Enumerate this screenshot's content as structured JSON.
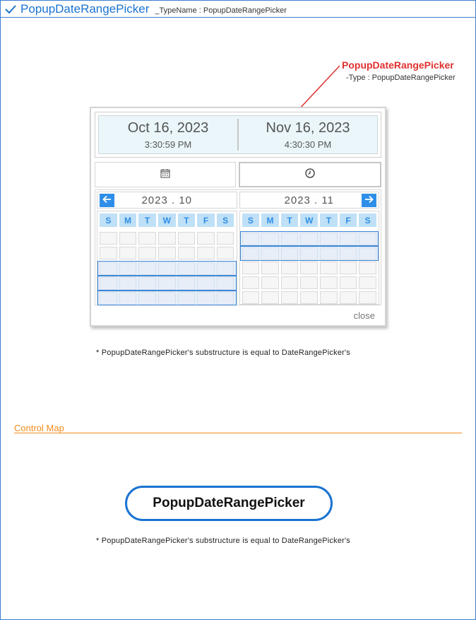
{
  "header": {
    "title": "PopupDateRangePicker",
    "typename": "_TypeName : PopupDateRangePicker"
  },
  "callout": {
    "title": "PopupDateRangePicker",
    "type": "-Type : PopupDateRangePicker"
  },
  "picker": {
    "start": {
      "date": "Oct 16, 2023",
      "time": "3:30:59 PM"
    },
    "end": {
      "date": "Nov 16, 2023",
      "time": "4:30:30 PM"
    },
    "tabs": [
      {
        "icon": "calendar-icon"
      },
      {
        "icon": "clock-icon"
      }
    ],
    "left_month": "2023 . 10",
    "right_month": "2023 . 11",
    "weekdays": [
      "S",
      "M",
      "T",
      "W",
      "T",
      "F",
      "S"
    ],
    "close_label": "close"
  },
  "note": "*  PopupDateRangePicker's substructure is equal to DateRangePicker's",
  "control_map": {
    "section_title": "Control Map",
    "node_label": "PopupDateRangePicker",
    "note": "*  PopupDateRangePicker's substructure is equal to DateRangePicker's"
  },
  "colors": {
    "accent_blue": "#1a73d1",
    "callout_red": "#e03030",
    "section_orange": "#f08c1a",
    "nav_blue": "#2e8ee8"
  }
}
